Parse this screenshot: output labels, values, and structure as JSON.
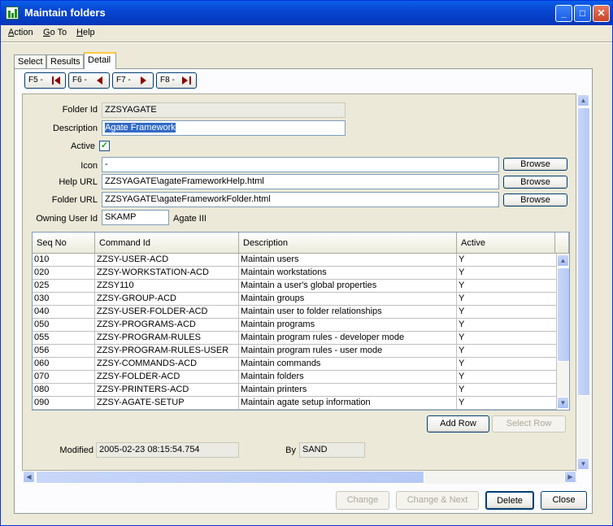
{
  "window": {
    "title": "Maintain folders"
  },
  "menu": [
    {
      "key": "A",
      "rest": "ction"
    },
    {
      "key": "G",
      "rest": "o To"
    },
    {
      "key": "H",
      "rest": "elp"
    }
  ],
  "tabs": [
    {
      "label": "Select"
    },
    {
      "label": "Results"
    },
    {
      "label": "Detail"
    }
  ],
  "nav_buttons": [
    {
      "label": "F5 -",
      "icon": "first-record-icon"
    },
    {
      "label": "F6 -",
      "icon": "previous-record-icon"
    },
    {
      "label": "F7 -",
      "icon": "next-record-icon"
    },
    {
      "label": "F8 -",
      "icon": "last-record-icon"
    }
  ],
  "form": {
    "folder_id_label": "Folder Id",
    "folder_id": "ZZSYAGATE",
    "description_label": "Description",
    "description": "Agate Framework",
    "active_label": "Active",
    "active_checked": true,
    "icon_label": "Icon",
    "icon_value": "-",
    "help_url_label": "Help URL",
    "help_url": "ZZSYAGATE\\agateFrameworkHelp.html",
    "folder_url_label": "Folder URL",
    "folder_url": "ZZSYAGATE\\agateFrameworkFolder.html",
    "owner_label": "Owning User Id",
    "owner_id": "SKAMP",
    "owner_name": "Agate III",
    "browse_label": "Browse"
  },
  "table": {
    "columns": [
      "Seq No",
      "Command Id",
      "Description",
      "Active"
    ],
    "rows": [
      [
        "010",
        "ZZSY-USER-ACD",
        "Maintain users",
        "Y"
      ],
      [
        "020",
        "ZZSY-WORKSTATION-ACD",
        "Maintain workstations",
        "Y"
      ],
      [
        "025",
        "ZZSY110",
        "Maintain a user's global properties",
        "Y"
      ],
      [
        "030",
        "ZZSY-GROUP-ACD",
        "Maintain groups",
        "Y"
      ],
      [
        "040",
        "ZZSY-USER-FOLDER-ACD",
        "Maintain user to folder relationships",
        "Y"
      ],
      [
        "050",
        "ZZSY-PROGRAMS-ACD",
        "Maintain programs",
        "Y"
      ],
      [
        "055",
        "ZZSY-PROGRAM-RULES",
        "Maintain program rules - developer mode",
        "Y"
      ],
      [
        "056",
        "ZZSY-PROGRAM-RULES-USER",
        "Maintain program rules - user mode",
        "Y"
      ],
      [
        "060",
        "ZZSY-COMMANDS-ACD",
        "Maintain commands",
        "Y"
      ],
      [
        "070",
        "ZZSY-FOLDER-ACD",
        "Maintain folders",
        "Y"
      ],
      [
        "080",
        "ZZSY-PRINTERS-ACD",
        "Maintain printers",
        "Y"
      ],
      [
        "090",
        "ZZSY-AGATE-SETUP",
        "Maintain agate setup information",
        "Y"
      ]
    ]
  },
  "row_buttons": {
    "add": "Add Row",
    "select": "Select Row"
  },
  "audit": {
    "modified_label": "Modified",
    "modified": "2005-02-23 08:15:54.754",
    "by_label": "By",
    "by": "SAND"
  },
  "footer": {
    "change": "Change",
    "change_next": "Change & Next",
    "delete": "Delete",
    "close": "Close"
  },
  "colors": {
    "titlebar": "#0846d2",
    "selection": "#316ac5",
    "tab_highlight": "#ffc83c"
  }
}
